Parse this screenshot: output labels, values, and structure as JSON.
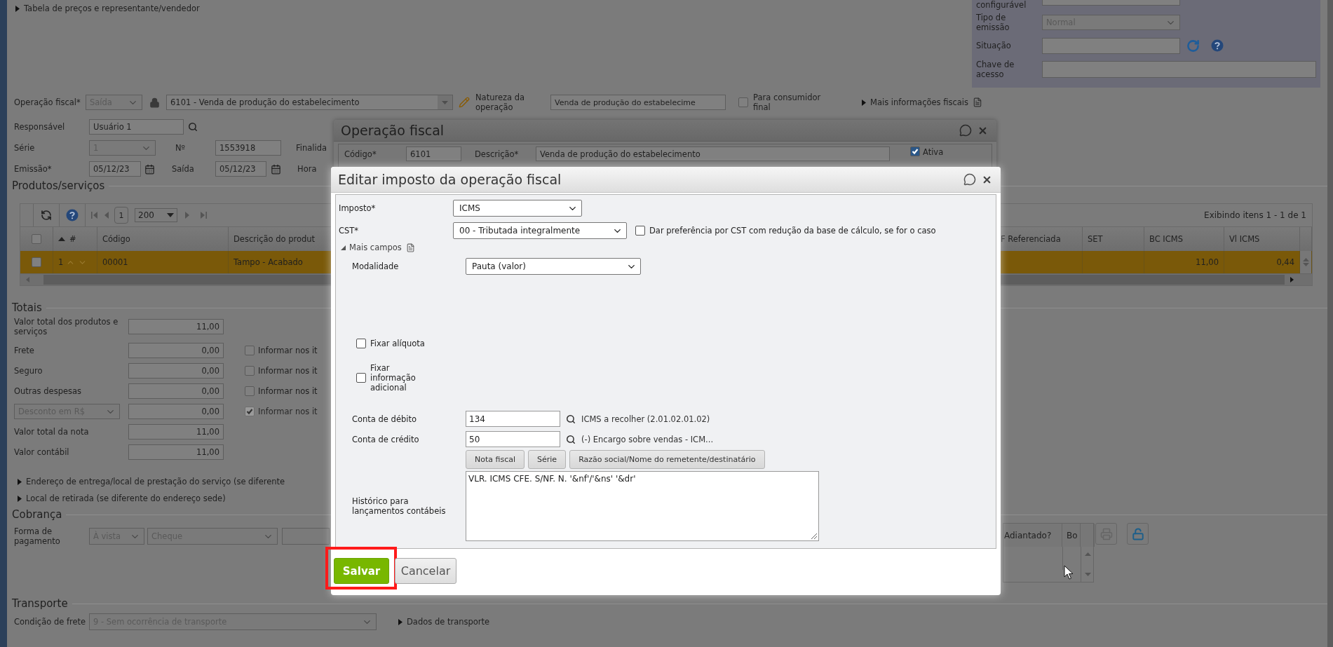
{
  "background_form": {
    "price_table_link": "Tabela de preços e representante/vendedor",
    "emission_panel": {
      "partial_label": "configurável",
      "emission_type": {
        "label": "Tipo de emissão",
        "value": "Normal",
        "disabled": true
      },
      "status_label": "Situação",
      "access_key_label": "Chave de acesso"
    },
    "fiscal_operation": {
      "label": "Operação fiscal*",
      "direction": "Saída",
      "direction_disabled": true,
      "value": "6101 - Venda de produção do estabelecimento"
    },
    "nature": {
      "label": "Natureza da operação",
      "value": "Venda de produção do estabelecime"
    },
    "final_consumer": {
      "label": "Para consumidor final",
      "checked": false
    },
    "more_fiscal_info": "Mais informações fiscais",
    "responsible": {
      "label": "Responsável",
      "value": "Usuário 1"
    },
    "series": {
      "label": "Série",
      "value": "1",
      "disabled": true
    },
    "number": {
      "label": "Nº",
      "value": "1553918"
    },
    "purpose_label": "Finalida",
    "issue": {
      "label": "Emissão*",
      "value": "05/12/23"
    },
    "exit": {
      "label": "Saída",
      "value": "05/12/23"
    },
    "time_label": "Hora"
  },
  "products": {
    "title": "Produtos/serviços",
    "page": "1",
    "page_size": "200",
    "summary": "Exibindo itens 1 - 1 de 1",
    "all_checked": false,
    "columns_left": [
      "#",
      "Código",
      "Descrição do produt"
    ],
    "columns_right": [
      "F Referenciada",
      "SET",
      "BC ICMS",
      "Vl ICMS"
    ],
    "rows": [
      {
        "selected": true,
        "checked": false,
        "number": "1",
        "code": "00001",
        "description": "Tampo - Acabado",
        "bc_icms": "11,00",
        "vl_icms": "0,44"
      }
    ]
  },
  "totals": {
    "title": "Totais",
    "rows": [
      {
        "kind": "plain",
        "label": "Valor total dos produtos e serviços",
        "value": "11,00"
      },
      {
        "kind": "itemized",
        "label": "Frete",
        "value": "0,00",
        "option": "Informar nos it",
        "checked": false,
        "disabled": false
      },
      {
        "kind": "itemized",
        "label": "Seguro",
        "value": "0,00",
        "option": "Informar nos it",
        "checked": false,
        "disabled": false
      },
      {
        "kind": "itemized",
        "label": "Outras despesas",
        "value": "0,00",
        "option": "Informar nos it",
        "checked": false,
        "disabled": false
      },
      {
        "kind": "discount",
        "label": "Desconto em R$",
        "value": "0,00",
        "option": "Informar nos it",
        "checked": true,
        "disabled": true
      },
      {
        "kind": "plain",
        "label": "Valor total da nota",
        "value": "11,00"
      },
      {
        "kind": "plain",
        "label": "Valor contábil",
        "value": "11,00"
      }
    ]
  },
  "address_sections": [
    "Endereço de entrega/local de prestação do serviço (se diferente",
    "Local de retirada (se diferente do endereço sede)"
  ],
  "billing": {
    "title": "Cobrança",
    "payment": {
      "label": "Forma de pagamento",
      "term": "À vista",
      "method": "Cheque",
      "disabled": true
    },
    "grid_columns": [
      "Adiantado?",
      "Bo"
    ]
  },
  "transport": {
    "title": "Transporte",
    "freight": {
      "label": "Condição de frete",
      "value": "9 - Sem ocorrência de transporte",
      "disabled": true
    },
    "details": "Dados de transporte"
  },
  "fiscal_operation_dialog": {
    "title": "Operação fiscal",
    "code": {
      "label": "Código*",
      "value": "6101"
    },
    "description": {
      "label": "Descrição*",
      "value": "Venda de produção do estabelecimento"
    },
    "active": {
      "label": "Ativa",
      "checked": true
    }
  },
  "tax_dialog": {
    "title": "Editar imposto da operação fiscal",
    "tax": {
      "label": "Imposto*",
      "value": "ICMS"
    },
    "cst": {
      "label": "CST*",
      "value": "00 - Tributada integralmente"
    },
    "prefer_reduction": {
      "label": "Dar preferência por CST com redução da base de cálculo, se for o caso",
      "checked": false
    },
    "more_fields": {
      "label": "Mais campos",
      "expanded": true
    },
    "modality": {
      "label": "Modalidade",
      "value": "Pauta (valor)"
    },
    "fix_rate": {
      "label": "Fixar alíquota",
      "checked": false
    },
    "fix_info": {
      "label": "Fixar informação adicional",
      "checked": false
    },
    "debit": {
      "label": "Conta de débito",
      "value": "134",
      "description": "ICMS a recolher (2.01.02.01.02)"
    },
    "credit": {
      "label": "Conta de crédito",
      "value": "50",
      "description": "(-) Encargo sobre vendas - ICM..."
    },
    "macros": [
      "Nota fiscal",
      "Série",
      "Razão social/Nome do remetente/destinatário"
    ],
    "history": {
      "label": "Histórico para lançamentos contábeis",
      "value": "VLR. ICMS CFE. S/NF. N. '&nf'/'&ns' '&dr'"
    },
    "buttons": [
      {
        "label": "Salvar",
        "kind": "primary",
        "highlighted": true
      },
      {
        "label": "Cancelar",
        "kind": "secondary",
        "highlighted": false
      }
    ]
  }
}
